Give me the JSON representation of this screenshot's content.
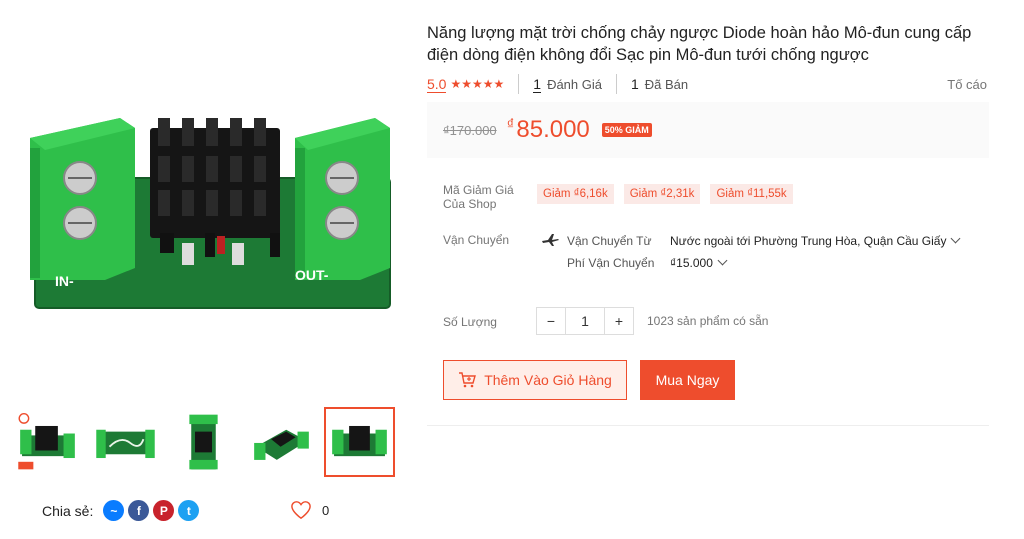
{
  "product": {
    "title": "Năng lượng mặt trời chống chảy ngược Diode hoàn hảo Mô-đun cung cấp điện dòng điện không đổi Sạc pin Mô-đun tưới chống ngược",
    "rating": "5.0",
    "stars": "★★★★★",
    "reviews_count": "1",
    "reviews_label": "Đánh Giá",
    "sold_count": "1",
    "sold_label": "Đã Bán",
    "report_label": "Tố cáo"
  },
  "price": {
    "old": "₫170.000",
    "currency": "₫",
    "current": "85.000",
    "discount_badge": "50% GIẢM"
  },
  "vouchers": {
    "label_line1": "Mã Giảm Giá",
    "label_line2": "Của Shop",
    "items": [
      "Giảm ₫6,16k",
      "Giảm ₫2,31k",
      "Giảm ₫11,55k"
    ]
  },
  "shipping": {
    "label": "Vận Chuyển",
    "from_label": "Vận Chuyển Từ",
    "from_value": "Nước ngoài tới Phường Trung Hòa, Quận Cầu Giấy",
    "fee_label": "Phí Vận Chuyển",
    "fee_value": "₫15.000"
  },
  "quantity": {
    "label": "Số Lượng",
    "minus": "−",
    "value": "1",
    "plus": "+",
    "stock": "1023 sản phẩm có sẵn"
  },
  "actions": {
    "add_to_cart": "Thêm Vào Giỏ Hàng",
    "buy_now": "Mua Ngay"
  },
  "image": {
    "label_in": "IN-",
    "label_out": "OUT-"
  },
  "share": {
    "label": "Chia sẻ:",
    "icons": [
      "messenger-icon",
      "facebook-icon",
      "pinterest-icon",
      "twitter-icon"
    ],
    "like_count": "0"
  },
  "colors": {
    "accent": "#ee4d2d",
    "pcb_green": "#1f8a3c",
    "terminal_green": "#2fbf4a"
  }
}
